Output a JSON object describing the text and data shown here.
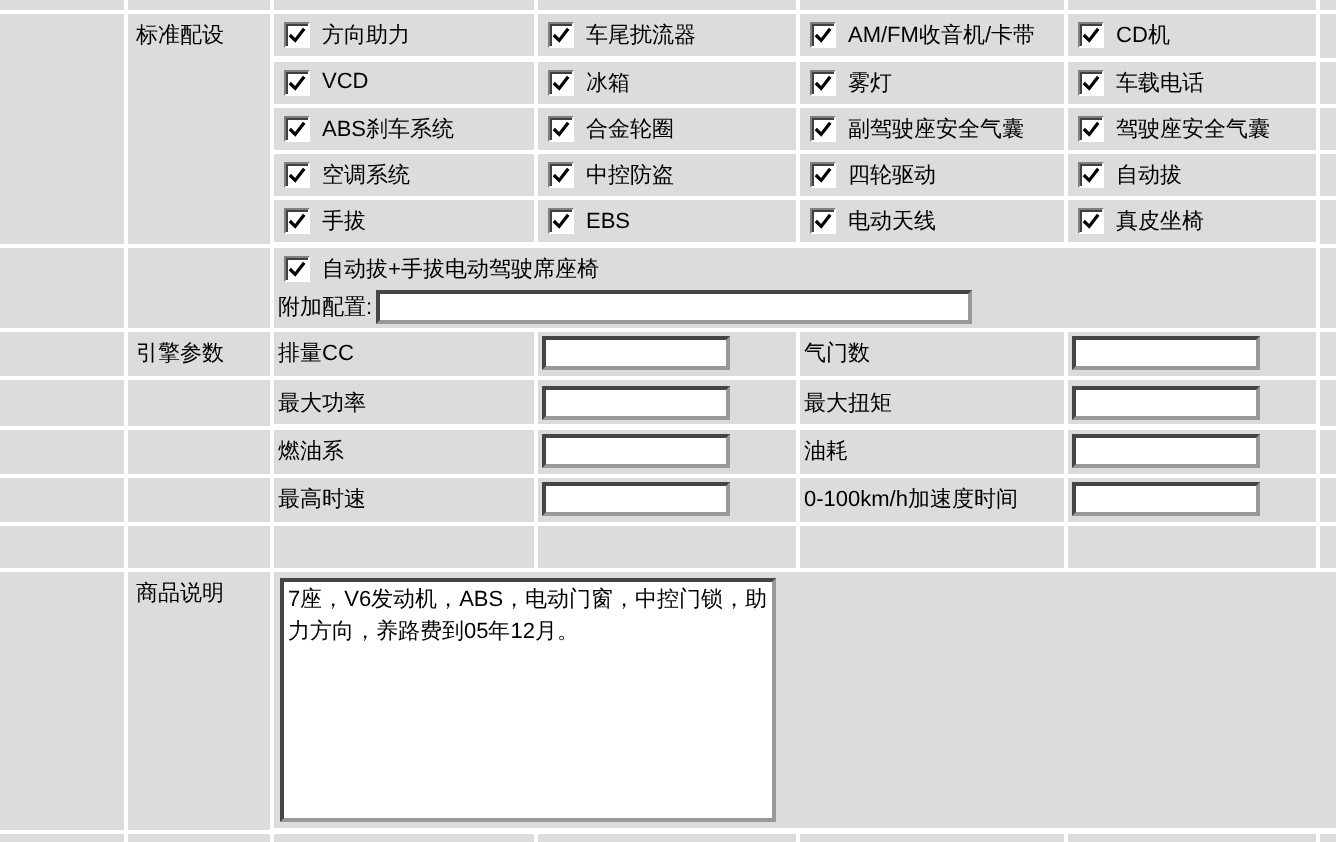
{
  "standard_equipment": {
    "label": "标准配设",
    "items": [
      {
        "label": "方向助力",
        "checked": true
      },
      {
        "label": "车尾扰流器",
        "checked": true
      },
      {
        "label": "AM/FM收音机/卡带",
        "checked": true
      },
      {
        "label": "CD机",
        "checked": true
      },
      {
        "label": "VCD",
        "checked": true
      },
      {
        "label": "冰箱",
        "checked": true
      },
      {
        "label": "雾灯",
        "checked": true
      },
      {
        "label": "车载电话",
        "checked": true
      },
      {
        "label": "ABS刹车系统",
        "checked": true
      },
      {
        "label": "合金轮圈",
        "checked": true
      },
      {
        "label": "副驾驶座安全气囊",
        "checked": true
      },
      {
        "label": "驾驶座安全气囊",
        "checked": true
      },
      {
        "label": "空调系统",
        "checked": true
      },
      {
        "label": "中控防盗",
        "checked": true
      },
      {
        "label": "四轮驱动",
        "checked": true
      },
      {
        "label": "自动拔",
        "checked": true
      },
      {
        "label": "手拔",
        "checked": true
      },
      {
        "label": "EBS",
        "checked": true
      },
      {
        "label": "电动天线",
        "checked": true
      },
      {
        "label": "真皮坐椅",
        "checked": true
      }
    ],
    "extra_item": {
      "label": "自动拔+手拔电动驾驶席座椅",
      "checked": true
    },
    "additional_config": {
      "label": "附加配置:"
    }
  },
  "engine_parameters": {
    "label": "引擎参数",
    "fields": [
      {
        "label": "排量CC"
      },
      {
        "label": "气门数"
      },
      {
        "label": "最大功率"
      },
      {
        "label": "最大扭矩"
      },
      {
        "label": "燃油系"
      },
      {
        "label": "油耗"
      },
      {
        "label": "最高时速"
      },
      {
        "label": "0-100km/h加速度时间"
      }
    ]
  },
  "product_description": {
    "label": "商品说明",
    "value": "7座，V6发动机，ABS，电动门窗，中控门锁，助力方向，养路费到05年12月。"
  }
}
